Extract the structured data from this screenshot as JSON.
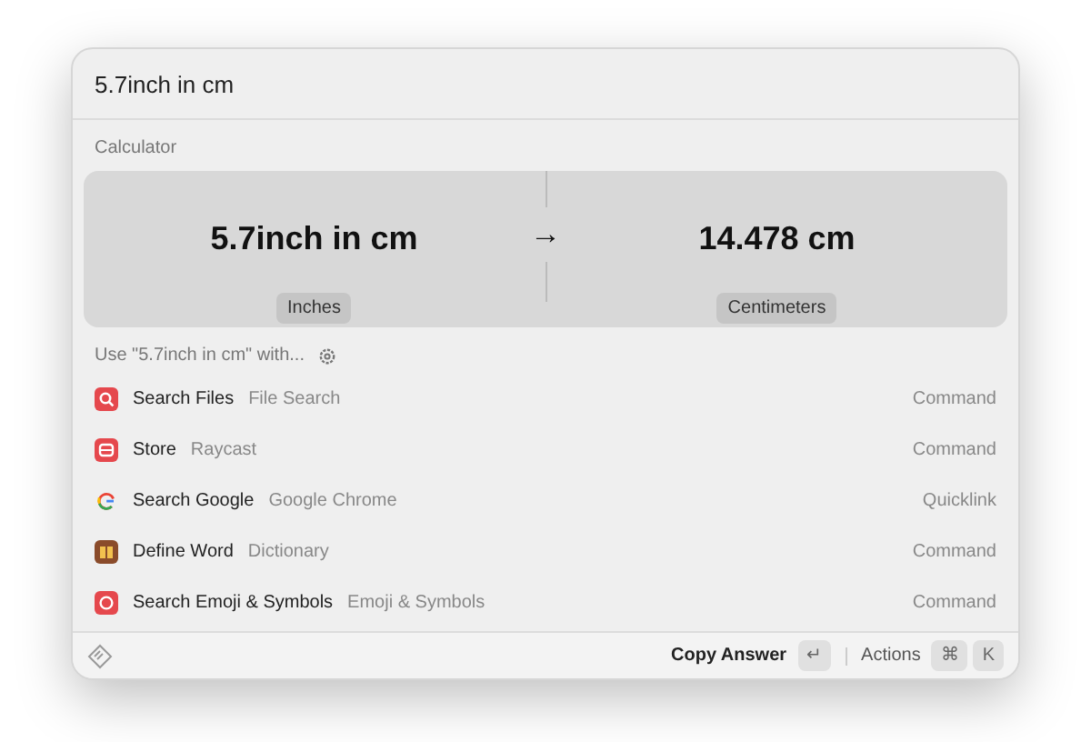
{
  "search": {
    "value": "5.7inch in cm"
  },
  "calculator": {
    "section_title": "Calculator",
    "from": {
      "value": "5.7inch in cm",
      "unit": "Inches"
    },
    "arrow": "→",
    "to": {
      "value": "14.478 cm",
      "unit": "Centimeters"
    }
  },
  "use_with": {
    "label": "Use \"5.7inch in cm\" with..."
  },
  "results": [
    {
      "kind": "search",
      "title": "Search Files",
      "subtitle": "File Search",
      "type": "Command",
      "color": "#e5484d"
    },
    {
      "kind": "store",
      "title": "Store",
      "subtitle": "Raycast",
      "type": "Command",
      "color": "#e5484d"
    },
    {
      "kind": "google",
      "title": "Search Google",
      "subtitle": "Google Chrome",
      "type": "Quicklink"
    },
    {
      "kind": "book",
      "title": "Define Word",
      "subtitle": "Dictionary",
      "type": "Command",
      "color": "#8a4b2a"
    },
    {
      "kind": "emoji",
      "title": "Search Emoji & Symbols",
      "subtitle": "Emoji & Symbols",
      "type": "Command",
      "color": "#e5484d"
    }
  ],
  "footer": {
    "primary_action": "Copy Answer",
    "primary_key": "↵",
    "actions_label": "Actions",
    "action_keys": [
      "⌘",
      "K"
    ]
  }
}
